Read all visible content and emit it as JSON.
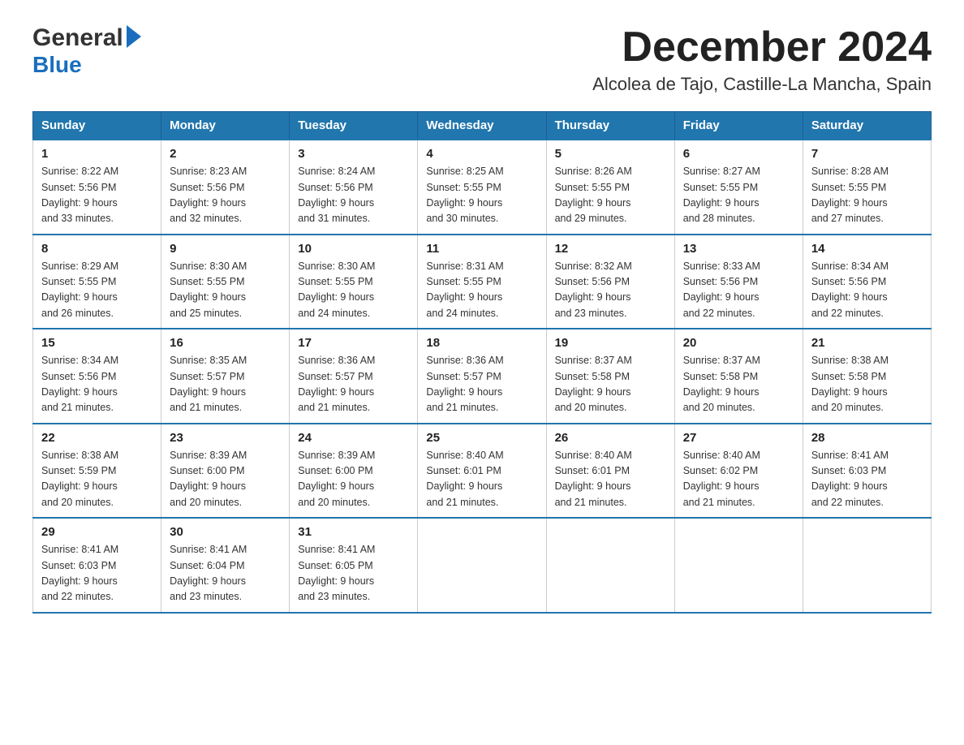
{
  "header": {
    "logo_general": "General",
    "logo_blue": "Blue",
    "month_title": "December 2024",
    "location": "Alcolea de Tajo, Castille-La Mancha, Spain"
  },
  "weekdays": [
    "Sunday",
    "Monday",
    "Tuesday",
    "Wednesday",
    "Thursday",
    "Friday",
    "Saturday"
  ],
  "weeks": [
    [
      {
        "day": "1",
        "sunrise": "8:22 AM",
        "sunset": "5:56 PM",
        "daylight": "9 hours and 33 minutes."
      },
      {
        "day": "2",
        "sunrise": "8:23 AM",
        "sunset": "5:56 PM",
        "daylight": "9 hours and 32 minutes."
      },
      {
        "day": "3",
        "sunrise": "8:24 AM",
        "sunset": "5:56 PM",
        "daylight": "9 hours and 31 minutes."
      },
      {
        "day": "4",
        "sunrise": "8:25 AM",
        "sunset": "5:55 PM",
        "daylight": "9 hours and 30 minutes."
      },
      {
        "day": "5",
        "sunrise": "8:26 AM",
        "sunset": "5:55 PM",
        "daylight": "9 hours and 29 minutes."
      },
      {
        "day": "6",
        "sunrise": "8:27 AM",
        "sunset": "5:55 PM",
        "daylight": "9 hours and 28 minutes."
      },
      {
        "day": "7",
        "sunrise": "8:28 AM",
        "sunset": "5:55 PM",
        "daylight": "9 hours and 27 minutes."
      }
    ],
    [
      {
        "day": "8",
        "sunrise": "8:29 AM",
        "sunset": "5:55 PM",
        "daylight": "9 hours and 26 minutes."
      },
      {
        "day": "9",
        "sunrise": "8:30 AM",
        "sunset": "5:55 PM",
        "daylight": "9 hours and 25 minutes."
      },
      {
        "day": "10",
        "sunrise": "8:30 AM",
        "sunset": "5:55 PM",
        "daylight": "9 hours and 24 minutes."
      },
      {
        "day": "11",
        "sunrise": "8:31 AM",
        "sunset": "5:55 PM",
        "daylight": "9 hours and 24 minutes."
      },
      {
        "day": "12",
        "sunrise": "8:32 AM",
        "sunset": "5:56 PM",
        "daylight": "9 hours and 23 minutes."
      },
      {
        "day": "13",
        "sunrise": "8:33 AM",
        "sunset": "5:56 PM",
        "daylight": "9 hours and 22 minutes."
      },
      {
        "day": "14",
        "sunrise": "8:34 AM",
        "sunset": "5:56 PM",
        "daylight": "9 hours and 22 minutes."
      }
    ],
    [
      {
        "day": "15",
        "sunrise": "8:34 AM",
        "sunset": "5:56 PM",
        "daylight": "9 hours and 21 minutes."
      },
      {
        "day": "16",
        "sunrise": "8:35 AM",
        "sunset": "5:57 PM",
        "daylight": "9 hours and 21 minutes."
      },
      {
        "day": "17",
        "sunrise": "8:36 AM",
        "sunset": "5:57 PM",
        "daylight": "9 hours and 21 minutes."
      },
      {
        "day": "18",
        "sunrise": "8:36 AM",
        "sunset": "5:57 PM",
        "daylight": "9 hours and 21 minutes."
      },
      {
        "day": "19",
        "sunrise": "8:37 AM",
        "sunset": "5:58 PM",
        "daylight": "9 hours and 20 minutes."
      },
      {
        "day": "20",
        "sunrise": "8:37 AM",
        "sunset": "5:58 PM",
        "daylight": "9 hours and 20 minutes."
      },
      {
        "day": "21",
        "sunrise": "8:38 AM",
        "sunset": "5:58 PM",
        "daylight": "9 hours and 20 minutes."
      }
    ],
    [
      {
        "day": "22",
        "sunrise": "8:38 AM",
        "sunset": "5:59 PM",
        "daylight": "9 hours and 20 minutes."
      },
      {
        "day": "23",
        "sunrise": "8:39 AM",
        "sunset": "6:00 PM",
        "daylight": "9 hours and 20 minutes."
      },
      {
        "day": "24",
        "sunrise": "8:39 AM",
        "sunset": "6:00 PM",
        "daylight": "9 hours and 20 minutes."
      },
      {
        "day": "25",
        "sunrise": "8:40 AM",
        "sunset": "6:01 PM",
        "daylight": "9 hours and 21 minutes."
      },
      {
        "day": "26",
        "sunrise": "8:40 AM",
        "sunset": "6:01 PM",
        "daylight": "9 hours and 21 minutes."
      },
      {
        "day": "27",
        "sunrise": "8:40 AM",
        "sunset": "6:02 PM",
        "daylight": "9 hours and 21 minutes."
      },
      {
        "day": "28",
        "sunrise": "8:41 AM",
        "sunset": "6:03 PM",
        "daylight": "9 hours and 22 minutes."
      }
    ],
    [
      {
        "day": "29",
        "sunrise": "8:41 AM",
        "sunset": "6:03 PM",
        "daylight": "9 hours and 22 minutes."
      },
      {
        "day": "30",
        "sunrise": "8:41 AM",
        "sunset": "6:04 PM",
        "daylight": "9 hours and 23 minutes."
      },
      {
        "day": "31",
        "sunrise": "8:41 AM",
        "sunset": "6:05 PM",
        "daylight": "9 hours and 23 minutes."
      },
      null,
      null,
      null,
      null
    ]
  ]
}
